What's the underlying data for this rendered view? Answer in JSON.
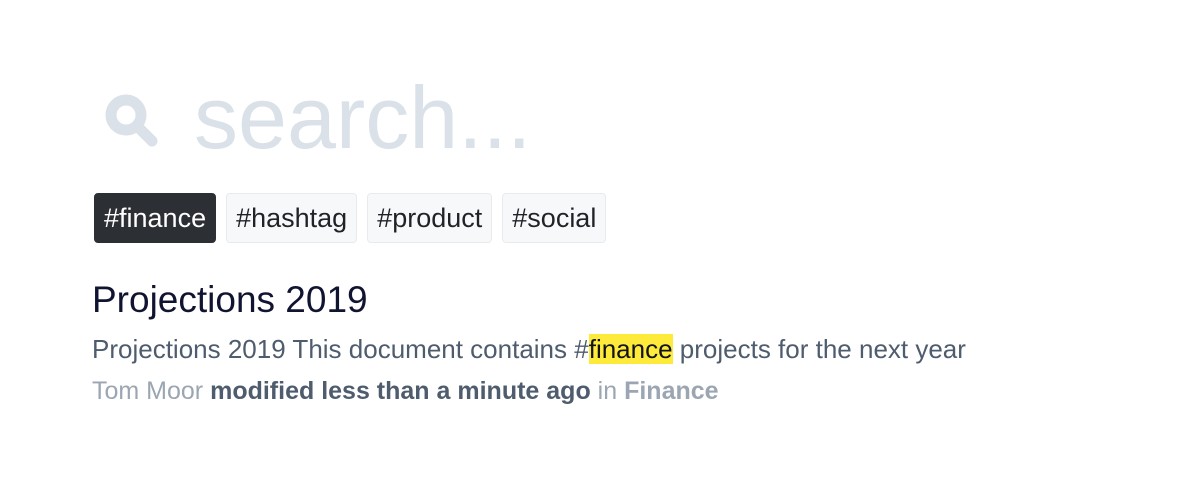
{
  "search": {
    "placeholder": "search..."
  },
  "tags": [
    {
      "label": "#finance",
      "active": true
    },
    {
      "label": "#hashtag",
      "active": false
    },
    {
      "label": "#product",
      "active": false
    },
    {
      "label": "#social",
      "active": false
    }
  ],
  "result": {
    "title": "Projections 2019",
    "snippet_before": "Projections 2019 This document contains #",
    "snippet_highlight": "finance",
    "snippet_after": " projects for the next year",
    "author": "Tom Moor",
    "modified": "modified less than a minute ago",
    "in": "in",
    "collection": "Finance"
  },
  "colors": {
    "placeholder": "#dae1e9",
    "tag_active_bg": "#2c2f33",
    "highlight": "#fdea3a"
  },
  "icons": {
    "search": "search-icon"
  }
}
